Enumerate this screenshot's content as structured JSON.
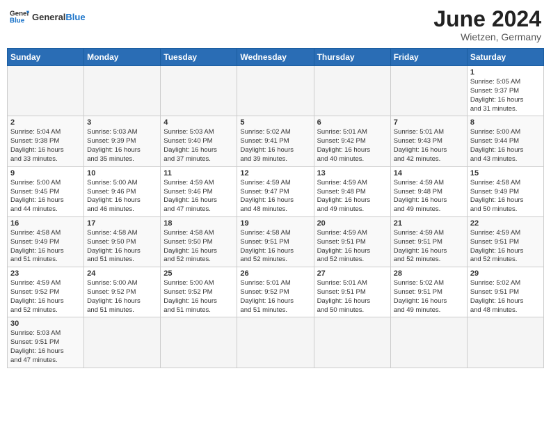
{
  "header": {
    "logo_general": "General",
    "logo_blue": "Blue",
    "month_year": "June 2024",
    "location": "Wietzen, Germany"
  },
  "weekdays": [
    "Sunday",
    "Monday",
    "Tuesday",
    "Wednesday",
    "Thursday",
    "Friday",
    "Saturday"
  ],
  "weeks": [
    [
      {
        "day": "",
        "info": ""
      },
      {
        "day": "",
        "info": ""
      },
      {
        "day": "",
        "info": ""
      },
      {
        "day": "",
        "info": ""
      },
      {
        "day": "",
        "info": ""
      },
      {
        "day": "",
        "info": ""
      },
      {
        "day": "1",
        "info": "Sunrise: 5:05 AM\nSunset: 9:37 PM\nDaylight: 16 hours\nand 31 minutes."
      }
    ],
    [
      {
        "day": "2",
        "info": "Sunrise: 5:04 AM\nSunset: 9:38 PM\nDaylight: 16 hours\nand 33 minutes."
      },
      {
        "day": "3",
        "info": "Sunrise: 5:03 AM\nSunset: 9:39 PM\nDaylight: 16 hours\nand 35 minutes."
      },
      {
        "day": "4",
        "info": "Sunrise: 5:03 AM\nSunset: 9:40 PM\nDaylight: 16 hours\nand 37 minutes."
      },
      {
        "day": "5",
        "info": "Sunrise: 5:02 AM\nSunset: 9:41 PM\nDaylight: 16 hours\nand 39 minutes."
      },
      {
        "day": "6",
        "info": "Sunrise: 5:01 AM\nSunset: 9:42 PM\nDaylight: 16 hours\nand 40 minutes."
      },
      {
        "day": "7",
        "info": "Sunrise: 5:01 AM\nSunset: 9:43 PM\nDaylight: 16 hours\nand 42 minutes."
      },
      {
        "day": "8",
        "info": "Sunrise: 5:00 AM\nSunset: 9:44 PM\nDaylight: 16 hours\nand 43 minutes."
      }
    ],
    [
      {
        "day": "9",
        "info": "Sunrise: 5:00 AM\nSunset: 9:45 PM\nDaylight: 16 hours\nand 44 minutes."
      },
      {
        "day": "10",
        "info": "Sunrise: 5:00 AM\nSunset: 9:46 PM\nDaylight: 16 hours\nand 46 minutes."
      },
      {
        "day": "11",
        "info": "Sunrise: 4:59 AM\nSunset: 9:46 PM\nDaylight: 16 hours\nand 47 minutes."
      },
      {
        "day": "12",
        "info": "Sunrise: 4:59 AM\nSunset: 9:47 PM\nDaylight: 16 hours\nand 48 minutes."
      },
      {
        "day": "13",
        "info": "Sunrise: 4:59 AM\nSunset: 9:48 PM\nDaylight: 16 hours\nand 49 minutes."
      },
      {
        "day": "14",
        "info": "Sunrise: 4:59 AM\nSunset: 9:48 PM\nDaylight: 16 hours\nand 49 minutes."
      },
      {
        "day": "15",
        "info": "Sunrise: 4:58 AM\nSunset: 9:49 PM\nDaylight: 16 hours\nand 50 minutes."
      }
    ],
    [
      {
        "day": "16",
        "info": "Sunrise: 4:58 AM\nSunset: 9:49 PM\nDaylight: 16 hours\nand 51 minutes."
      },
      {
        "day": "17",
        "info": "Sunrise: 4:58 AM\nSunset: 9:50 PM\nDaylight: 16 hours\nand 51 minutes."
      },
      {
        "day": "18",
        "info": "Sunrise: 4:58 AM\nSunset: 9:50 PM\nDaylight: 16 hours\nand 52 minutes."
      },
      {
        "day": "19",
        "info": "Sunrise: 4:58 AM\nSunset: 9:51 PM\nDaylight: 16 hours\nand 52 minutes."
      },
      {
        "day": "20",
        "info": "Sunrise: 4:59 AM\nSunset: 9:51 PM\nDaylight: 16 hours\nand 52 minutes."
      },
      {
        "day": "21",
        "info": "Sunrise: 4:59 AM\nSunset: 9:51 PM\nDaylight: 16 hours\nand 52 minutes."
      },
      {
        "day": "22",
        "info": "Sunrise: 4:59 AM\nSunset: 9:51 PM\nDaylight: 16 hours\nand 52 minutes."
      }
    ],
    [
      {
        "day": "23",
        "info": "Sunrise: 4:59 AM\nSunset: 9:52 PM\nDaylight: 16 hours\nand 52 minutes."
      },
      {
        "day": "24",
        "info": "Sunrise: 5:00 AM\nSunset: 9:52 PM\nDaylight: 16 hours\nand 51 minutes."
      },
      {
        "day": "25",
        "info": "Sunrise: 5:00 AM\nSunset: 9:52 PM\nDaylight: 16 hours\nand 51 minutes."
      },
      {
        "day": "26",
        "info": "Sunrise: 5:01 AM\nSunset: 9:52 PM\nDaylight: 16 hours\nand 51 minutes."
      },
      {
        "day": "27",
        "info": "Sunrise: 5:01 AM\nSunset: 9:51 PM\nDaylight: 16 hours\nand 50 minutes."
      },
      {
        "day": "28",
        "info": "Sunrise: 5:02 AM\nSunset: 9:51 PM\nDaylight: 16 hours\nand 49 minutes."
      },
      {
        "day": "29",
        "info": "Sunrise: 5:02 AM\nSunset: 9:51 PM\nDaylight: 16 hours\nand 48 minutes."
      }
    ],
    [
      {
        "day": "30",
        "info": "Sunrise: 5:03 AM\nSunset: 9:51 PM\nDaylight: 16 hours\nand 47 minutes."
      },
      {
        "day": "",
        "info": ""
      },
      {
        "day": "",
        "info": ""
      },
      {
        "day": "",
        "info": ""
      },
      {
        "day": "",
        "info": ""
      },
      {
        "day": "",
        "info": ""
      },
      {
        "day": "",
        "info": ""
      }
    ]
  ]
}
